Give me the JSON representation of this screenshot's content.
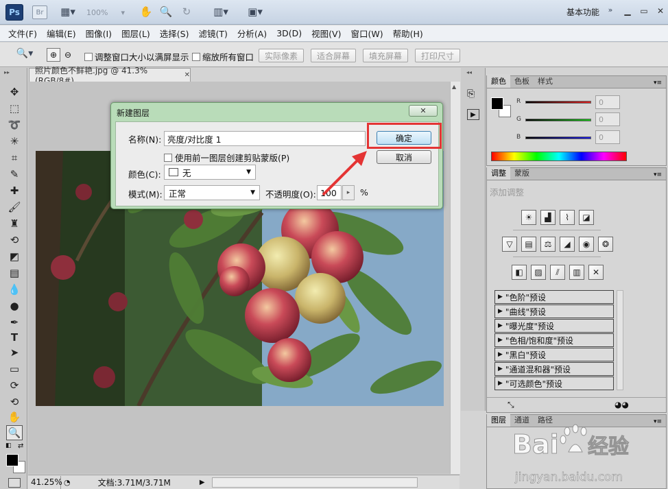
{
  "app": {
    "logo": "Ps",
    "bridge": "Br",
    "zoom_level": "100%",
    "workspace": "基本功能"
  },
  "menu": [
    "文件(F)",
    "编辑(E)",
    "图像(I)",
    "图层(L)",
    "选择(S)",
    "滤镜(T)",
    "分析(A)",
    "3D(D)",
    "视图(V)",
    "窗口(W)",
    "帮助(H)"
  ],
  "options": {
    "resize_windows": "调整窗口大小以满屏显示",
    "zoom_all": "缩放所有窗口",
    "actual_pixels": "实际像素",
    "fit_screen": "适合屏幕",
    "fill_screen": "填充屏幕",
    "print_size": "打印尺寸"
  },
  "document": {
    "tab_title": "照片颜色不鲜艳.jpg @ 41.3%(RGB/8#)",
    "status_zoom": "41.25%",
    "status_doc": "文档:3.71M/3.71M"
  },
  "color_panel": {
    "tabs": [
      "颜色",
      "色板",
      "样式"
    ],
    "channels": [
      {
        "label": "R",
        "value": "0",
        "color": "#d81f1f"
      },
      {
        "label": "G",
        "value": "0",
        "color": "#17b817"
      },
      {
        "label": "B",
        "value": "0",
        "color": "#1a1ad8"
      }
    ]
  },
  "adjust_panel": {
    "tabs": [
      "调整",
      "蒙版"
    ],
    "heading": "添加调整",
    "presets": [
      "\"色阶\"预设",
      "\"曲线\"预设",
      "\"曝光度\"预设",
      "\"色相/饱和度\"预设",
      "\"黑白\"预设",
      "\"通道混和器\"预设",
      "\"可选颜色\"预设"
    ]
  },
  "layers_panel": {
    "tabs": [
      "图层",
      "通道",
      "路径"
    ]
  },
  "dialog": {
    "title": "新建图层",
    "name_label": "名称(N):",
    "name_value": "亮度/对比度 1",
    "clip_label": "使用前一图层创建剪贴蒙版(P)",
    "color_label": "颜色(C):",
    "color_value": "无",
    "mode_label": "模式(M):",
    "mode_value": "正常",
    "opacity_label": "不透明度(O):",
    "opacity_value": "100",
    "opacity_unit": "%",
    "ok": "确定",
    "cancel": "取消"
  },
  "watermark": {
    "brand": "Bai",
    "brand2": "du",
    "cn": "经验",
    "url": "jingyan.baidu.com"
  }
}
